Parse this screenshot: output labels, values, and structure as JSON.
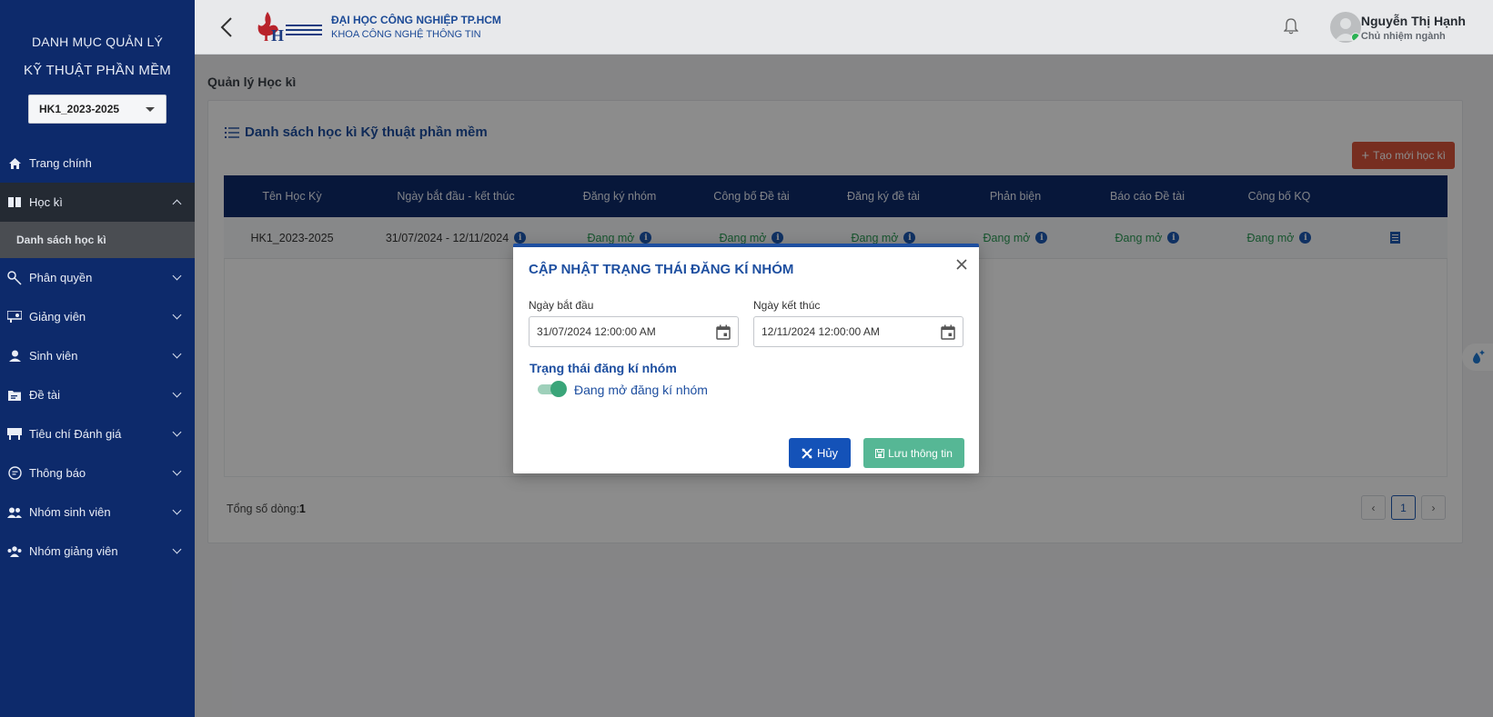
{
  "sidebar": {
    "title_line1": "DANH MỤC QUẢN LÝ",
    "title_line2": "KỸ THUẬT PHẦN MỀM",
    "term_select": "HK1_2023-2025",
    "items": [
      {
        "label": "Trang chính",
        "icon": "home-icon"
      },
      {
        "label": "Học kì",
        "icon": "book-icon"
      },
      {
        "label": "Phân quyền",
        "icon": "key-icon"
      },
      {
        "label": "Giảng viên",
        "icon": "teacher-icon"
      },
      {
        "label": "Sinh viên",
        "icon": "student-icon"
      },
      {
        "label": "Đề tài",
        "icon": "folder-icon"
      },
      {
        "label": "Tiêu chí Đánh giá",
        "icon": "criteria-icon"
      },
      {
        "label": "Thông báo",
        "icon": "message-icon"
      },
      {
        "label": "Nhóm sinh viên",
        "icon": "group-icon"
      },
      {
        "label": "Nhóm giảng viên",
        "icon": "team-icon"
      }
    ],
    "sub_item": "Danh sách học kì"
  },
  "header": {
    "university": "ĐẠI HỌC CÔNG NGHIỆP TP.HCM",
    "faculty": "KHOA CÔNG NGHỆ THÔNG TIN",
    "user_name": "Nguyễn Thị Hạnh",
    "user_role": "Chủ nhiệm ngành"
  },
  "content": {
    "breadcrumb": "Quản lý Học kì",
    "card_title": "Danh sách học kì Kỹ thuật phần mềm",
    "create_button": "Tạo mới học kì",
    "columns": [
      "Tên Học Kỳ",
      "Ngày bắt đầu - kết thúc",
      "Đăng ký nhóm",
      "Công bố Đề tài",
      "Đăng ký đề tài",
      "Phản biện",
      "Báo cáo Đề tài",
      "Công bố KQ"
    ],
    "row": {
      "name": "HK1_2023-2025",
      "dates": "31/07/2024  -  12/11/2024",
      "status": "Đang mở"
    },
    "total_label": "Tổng số dòng:",
    "total_value": "1",
    "page": "1"
  },
  "modal": {
    "title": "CẬP NHẬT TRẠNG THÁI ĐĂNG KÍ NHÓM",
    "start_label": "Ngày bắt đầu",
    "start_value": "31/07/2024 12:00:00 AM",
    "end_label": "Ngày kết thúc",
    "end_value": "12/11/2024 12:00:00 AM",
    "section_title": "Trạng thái đăng kí nhóm",
    "toggle_label": "Đang mở đăng kí nhóm",
    "toggle_on": true,
    "cancel_button": "Hủy",
    "save_button": "Lưu thông tin"
  },
  "colors": {
    "sidebar_bg": "#0d2a6b",
    "primary": "#1e4fa0",
    "create_btn": "#d9543b",
    "save_btn": "#56b795",
    "status_green": "#2a9a55"
  }
}
